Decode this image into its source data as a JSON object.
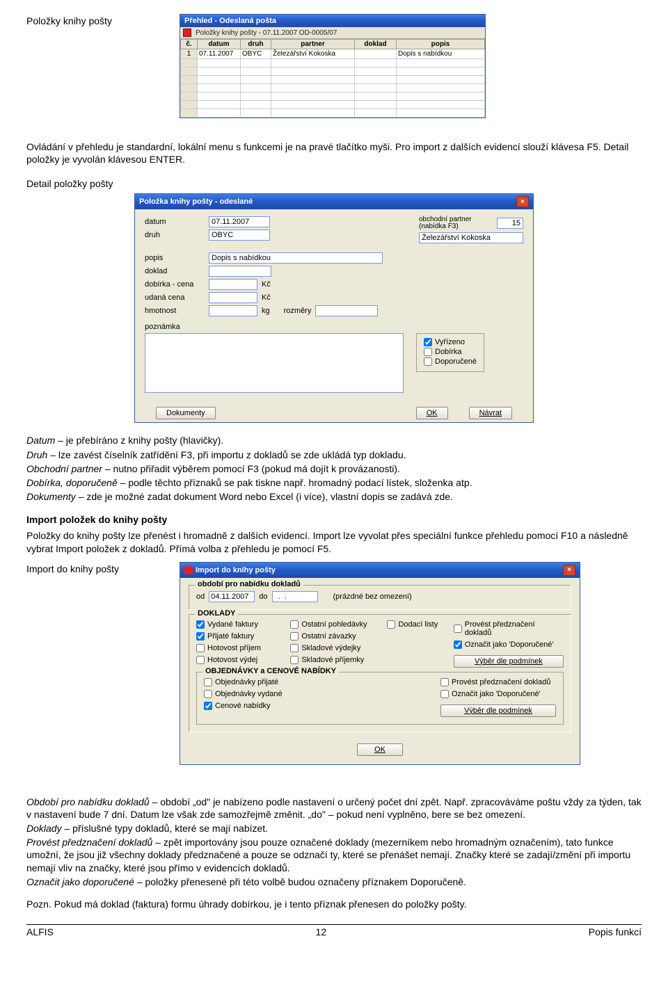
{
  "section1": {
    "title": "Položky knihy pošty",
    "intro": "Ovládání v přehledu je standardní, lokální menu s funkcemi je na pravé tlačítko myši. Pro import z dalších evidencí slouží klávesa F5. Detail položky je vyvolán klávesou ENTER."
  },
  "win1": {
    "title": "Přehled - Odeslaná pošta",
    "subtitle": "Položky knihy pošty - 07.11.2007 OD-0005/07",
    "headers": [
      "č.",
      "datum",
      "druh",
      "partner",
      "doklad",
      "popis"
    ],
    "row": [
      "1",
      "07.11.2007",
      "OBYC",
      "Železářství Kokoska",
      "",
      "Dopis s nabídkou"
    ]
  },
  "section2": {
    "title": "Detail položky pošty",
    "datum_lbl": "Datum",
    "datum_text": " – je přebíráno z knihy pošty (hlavičky).",
    "druh_lbl": "Druh",
    "druh_text": " – lze zavést číselník zatřídění F3, při importu z dokladů se zde ukládá typ dokladu.",
    "partner_lbl": "Obchodní partner",
    "partner_text": " – nutno přiřadit výběrem pomocí F3 (pokud má dojít k provázanosti).",
    "dobirka_lbl": "Dobírka, doporučeně",
    "dobirka_text": " – podle těchto příznaků se pak tiskne např. hromadný podací lístek, složenka atp.",
    "dokumenty_lbl": "Dokumenty",
    "dokumenty_text": " – zde je možné zadat dokument Word nebo Excel (i více), vlastní dopis se zadává zde."
  },
  "win2": {
    "title": "Položka knihy pošty - odeslané",
    "labels": {
      "datum": "datum",
      "druh": "druh",
      "partner": "obchodní partner (nabídka F3)",
      "popis": "popis",
      "doklad": "doklad",
      "dobirka": "dobírka - cena",
      "udana": "udaná cena",
      "hmotnost": "hmotnost",
      "rozmery": "rozměry",
      "poznamka": "poznámka",
      "kc": "Kč",
      "kg": "kg"
    },
    "values": {
      "datum": "07.11.2007",
      "druh": "OBYC",
      "partner_id": "15",
      "partner": "Železářství Kokoska",
      "popis": "Dopis s nabídkou"
    },
    "checks": {
      "vyrizeno": "Vyřízeno",
      "dobirka": "Dobírka",
      "doporucene": "Doporučené"
    },
    "buttons": {
      "dokumenty": "Dokumenty",
      "ok": "OK",
      "navrat": "Návrat"
    }
  },
  "section3": {
    "heading": "Import položek do knihy pošty",
    "text": "Položky do knihy pošty lze přenést i hromadně z dalších evidencí. Import lze vyvolat přes speciální funkce přehledu pomocí F10 a následně vybrat Import položek z dokladů. Přímá volba z přehledu je pomocí F5.",
    "subtitle": "Import do knihy pošty"
  },
  "win3": {
    "title": "Import do knihy pošty",
    "grp_period": "období pro nabídku dokladů",
    "od_lbl": "od",
    "do_lbl": "do",
    "od_val": "04.11.2007",
    "do_val": "  .  .    ",
    "empty_hint": "(prázdné bez omezení)",
    "grp_doklady": "DOKLADY",
    "grp_obj": "OBJEDNÁVKY a CENOVÉ NABÍDKY",
    "checks1": {
      "vf": "Vydané faktury",
      "pf": "Přijaté faktury",
      "hp": "Hotovost příjem",
      "hv": "Hotovost výdej",
      "op": "Ostatní pohledávky",
      "oz": "Ostatní závazky",
      "sv": "Skladové výdejky",
      "sp": "Skladové příjemky",
      "dl": "Dodací listy"
    },
    "checks2": {
      "objp": "Objednávky přijaté",
      "objv": "Objednávky vydané",
      "cn": "Cenové nabídky"
    },
    "side": {
      "pred": "Provést předznačení dokladů",
      "ozn": "Označit jako 'Doporučené'",
      "vyber": "Výběr dle podmínek"
    },
    "ok": "OK"
  },
  "section4": {
    "p1_lbl": "Období pro nabídku dokladů",
    "p1_txt": " – období „od\" je nabízeno podle nastavení o určený počet dní zpět. Např. zpracováváme poštu vždy za týden, tak v nastavení bude 7 dní. Datum lze však zde samozřejmě změnit. „do\" – pokud není vyplněno, bere se bez omezení.",
    "p2_lbl": "Doklady",
    "p2_txt": " – příslušné typy dokladů, které se mají nabízet.",
    "p3_lbl": "Provést předznačení dokladů",
    "p3_txt": " – zpět importovány jsou pouze označené doklady (mezerníkem nebo hromadným označením), tato funkce umožní, že jsou již všechny doklady předznačené a pouze se odznačí ty, které se přenášet nemají. Značky které se zadají/změní při importu nemají vliv na značky, které jsou přímo v evidencích dokladů.",
    "p4_lbl": "Označit jako doporučené",
    "p4_txt": " – položky přenesené při této volbě budou označeny příznakem Doporučeně.",
    "note": "Pozn. Pokud má doklad (faktura) formu úhrady dobírkou, je i tento příznak přenesen do položky pošty."
  },
  "footer": {
    "left": "ALFIS",
    "center": "12",
    "right": "Popis funkcí"
  }
}
